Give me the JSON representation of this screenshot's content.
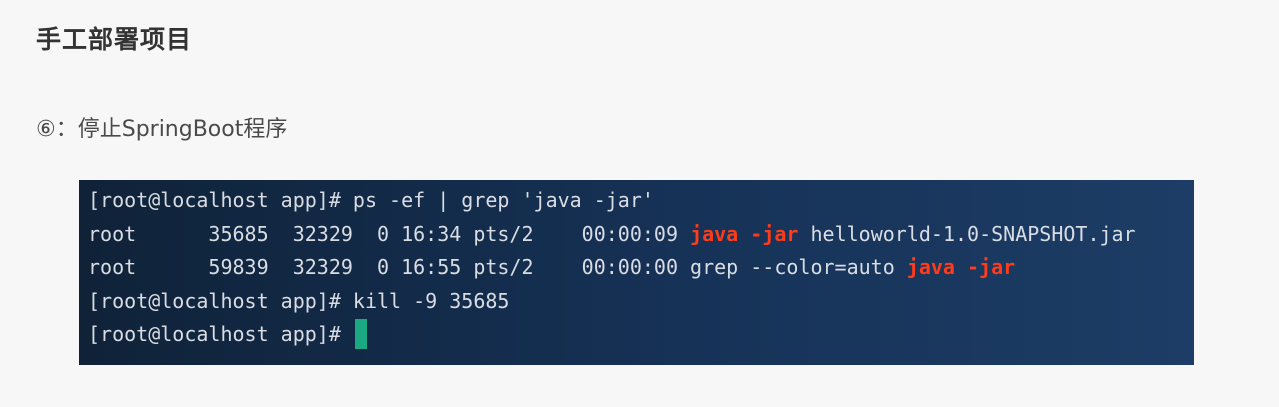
{
  "heading": "手工部署项目",
  "step_label": "⑥：停止SpringBoot程序",
  "terminal": {
    "line1": {
      "prompt": "[root@localhost app]# ",
      "command": "ps -ef | grep 'java -jar'"
    },
    "line2": {
      "prefix": "root      35685  32329  0 16:34 pts/2    00:00:09 ",
      "hl1": "java",
      "sep": " ",
      "hl2": "-jar",
      "suffix": " helloworld-1.0-SNAPSHOT.jar"
    },
    "line3": {
      "prefix": "root      59839  32329  0 16:55 pts/2    00:00:00 grep --color=auto ",
      "hl1": "java",
      "sep": " ",
      "hl2": "-jar"
    },
    "line4": {
      "prompt": "[root@localhost app]# ",
      "command": "kill -9 35685"
    },
    "line5": {
      "prompt": "[root@localhost app]# "
    },
    "colors": {
      "highlight": "#ff3b1a",
      "cursor": "#1aa982",
      "text": "#d9dde3"
    }
  }
}
